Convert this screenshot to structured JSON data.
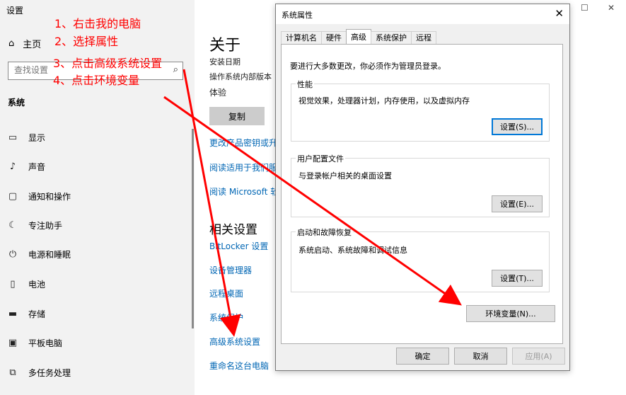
{
  "settings": {
    "window_title": "设置",
    "home_label": "主页",
    "search_placeholder": "查找设置",
    "section": "系统",
    "nav": [
      {
        "icon": "display-icon",
        "glyph": "▭",
        "label": "显示"
      },
      {
        "icon": "sound-icon",
        "glyph": "♪",
        "label": "声音"
      },
      {
        "icon": "notifications-icon",
        "glyph": "▢",
        "label": "通知和操作"
      },
      {
        "icon": "focus-assist-icon",
        "glyph": "☾",
        "label": "专注助手"
      },
      {
        "icon": "power-icon",
        "glyph": "⏻",
        "label": "电源和睡眠"
      },
      {
        "icon": "battery-icon",
        "glyph": "▯",
        "label": "电池"
      },
      {
        "icon": "storage-icon",
        "glyph": "▬",
        "label": "存储"
      },
      {
        "icon": "tablet-icon",
        "glyph": "▣",
        "label": "平板电脑"
      },
      {
        "icon": "multitasking-icon",
        "glyph": "⧉",
        "label": "多任务处理"
      }
    ],
    "main": {
      "title": "关于",
      "install_date_label": "安装日期",
      "os_build_label": "操作系统内部版本",
      "experience_label": "体验",
      "copy_button": "复制",
      "links": [
        "更改产品密钥或升",
        "阅读适用于我们服",
        "阅读 Microsoft 软"
      ],
      "related_title": "相关设置",
      "related_links": [
        "BitLocker 设置",
        "设备管理器",
        "远程桌面",
        "系统保护",
        "高级系统设置",
        "重命名这台电脑"
      ]
    }
  },
  "annotations": [
    "1、右击我的电脑",
    "2、选择属性",
    "3、点击高级系统设置",
    "4、点击环境变量"
  ],
  "dialog": {
    "title": "系统属性",
    "tabs": [
      "计算机名",
      "硬件",
      "高级",
      "系统保护",
      "远程"
    ],
    "active_tab": 2,
    "admin_note": "要进行大多数更改，你必须作为管理员登录。",
    "groups": [
      {
        "legend": "性能",
        "desc": "视觉效果，处理器计划，内存使用，以及虚拟内存",
        "button": "设置(S)..."
      },
      {
        "legend": "用户配置文件",
        "desc": "与登录帐户相关的桌面设置",
        "button": "设置(E)..."
      },
      {
        "legend": "启动和故障恢复",
        "desc": "系统启动、系统故障和调试信息",
        "button": "设置(T)..."
      }
    ],
    "env_button": "环境变量(N)...",
    "ok": "确定",
    "cancel": "取消",
    "apply": "应用(A)"
  },
  "colors": {
    "accent_link": "#0066b4",
    "annotation": "#ff0000",
    "focus": "#0078d7"
  }
}
